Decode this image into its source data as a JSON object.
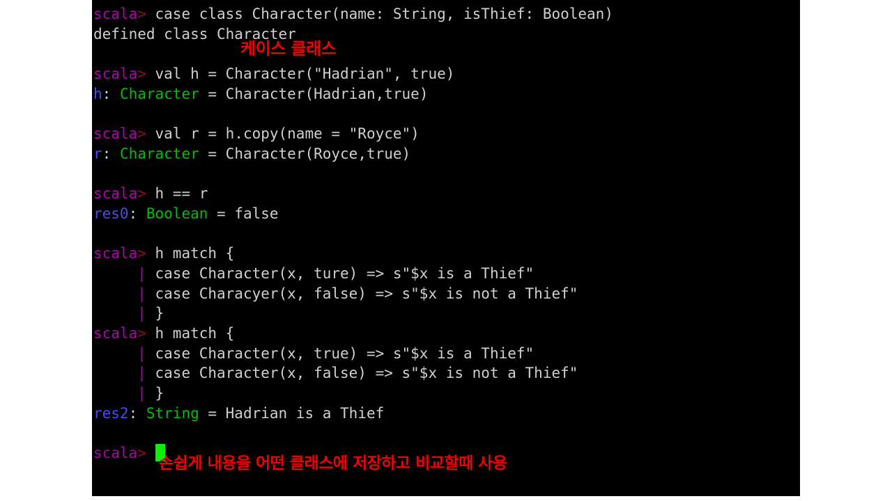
{
  "window": {
    "background_color": "#ffffff",
    "terminal_background": "#000000",
    "terminal_left": 132,
    "terminal_width": 1016,
    "terminal_height": 713
  },
  "colors": {
    "prompt_magenta": "#b000b0",
    "prompt_arrow_dark_red": "#8b0a2a",
    "identifier_blue": "#4a4aee",
    "type_green": "#00c000",
    "plain_text": "#cfcfcf",
    "cursor_green": "#0aee0a",
    "annotation_red": "#f00000"
  },
  "terminal": {
    "prompt_label": "scala>",
    "prompt_name": "scala",
    "prompt_arrow": ">",
    "continuation_pipe": "|",
    "lines": [
      {
        "kind": "prompt",
        "prompt": "scala>",
        "text": " case class Character(name: String, isThief: Boolean)"
      },
      {
        "kind": "output",
        "text": "defined class Character"
      },
      {
        "kind": "blank",
        "text": ""
      },
      {
        "kind": "prompt",
        "prompt": "scala>",
        "text": " val h = Character(\"Hadrian\", true)"
      },
      {
        "kind": "result",
        "ident": "h",
        "colon": ": ",
        "type": "Character",
        "rest": " = Character(Hadrian,true)"
      },
      {
        "kind": "blank",
        "text": ""
      },
      {
        "kind": "prompt",
        "prompt": "scala>",
        "text": " val r = h.copy(name = \"Royce\")"
      },
      {
        "kind": "result",
        "ident": "r",
        "colon": ": ",
        "type": "Character",
        "rest": " = Character(Royce,true)"
      },
      {
        "kind": "blank",
        "text": ""
      },
      {
        "kind": "prompt",
        "prompt": "scala>",
        "text": " h == r"
      },
      {
        "kind": "result",
        "ident": "res0",
        "colon": ": ",
        "type": "Boolean",
        "rest": " = false"
      },
      {
        "kind": "blank",
        "text": ""
      },
      {
        "kind": "prompt",
        "prompt": "scala>",
        "text": " h match {"
      },
      {
        "kind": "cont",
        "indent": "     ",
        "pipe": "|",
        "text": " case Character(x, ture) => s\"$x is a Thief\""
      },
      {
        "kind": "cont",
        "indent": "     ",
        "pipe": "|",
        "text": " case Characyer(x, false) => s\"$x is not a Thief\""
      },
      {
        "kind": "cont",
        "indent": "     ",
        "pipe": "|",
        "text": " }"
      },
      {
        "kind": "prompt",
        "prompt": "scala>",
        "text": " h match {"
      },
      {
        "kind": "cont",
        "indent": "     ",
        "pipe": "|",
        "text": " case Character(x, true) => s\"$x is a Thief\""
      },
      {
        "kind": "cont",
        "indent": "     ",
        "pipe": "|",
        "text": " case Character(x, false) => s\"$x is not a Thief\""
      },
      {
        "kind": "cont",
        "indent": "     ",
        "pipe": "|",
        "text": " }"
      },
      {
        "kind": "result",
        "ident": "res2",
        "colon": ": ",
        "type": "String",
        "rest": " = Hadrian is a Thief"
      },
      {
        "kind": "blank",
        "text": ""
      },
      {
        "kind": "cursor",
        "prompt": "scala>",
        "text": " "
      }
    ]
  },
  "annotations": {
    "case_class": "케이스 클래스",
    "usage": "손쉽게 내용을 어떤 클래스에 저장하고 비교할때 사용"
  }
}
